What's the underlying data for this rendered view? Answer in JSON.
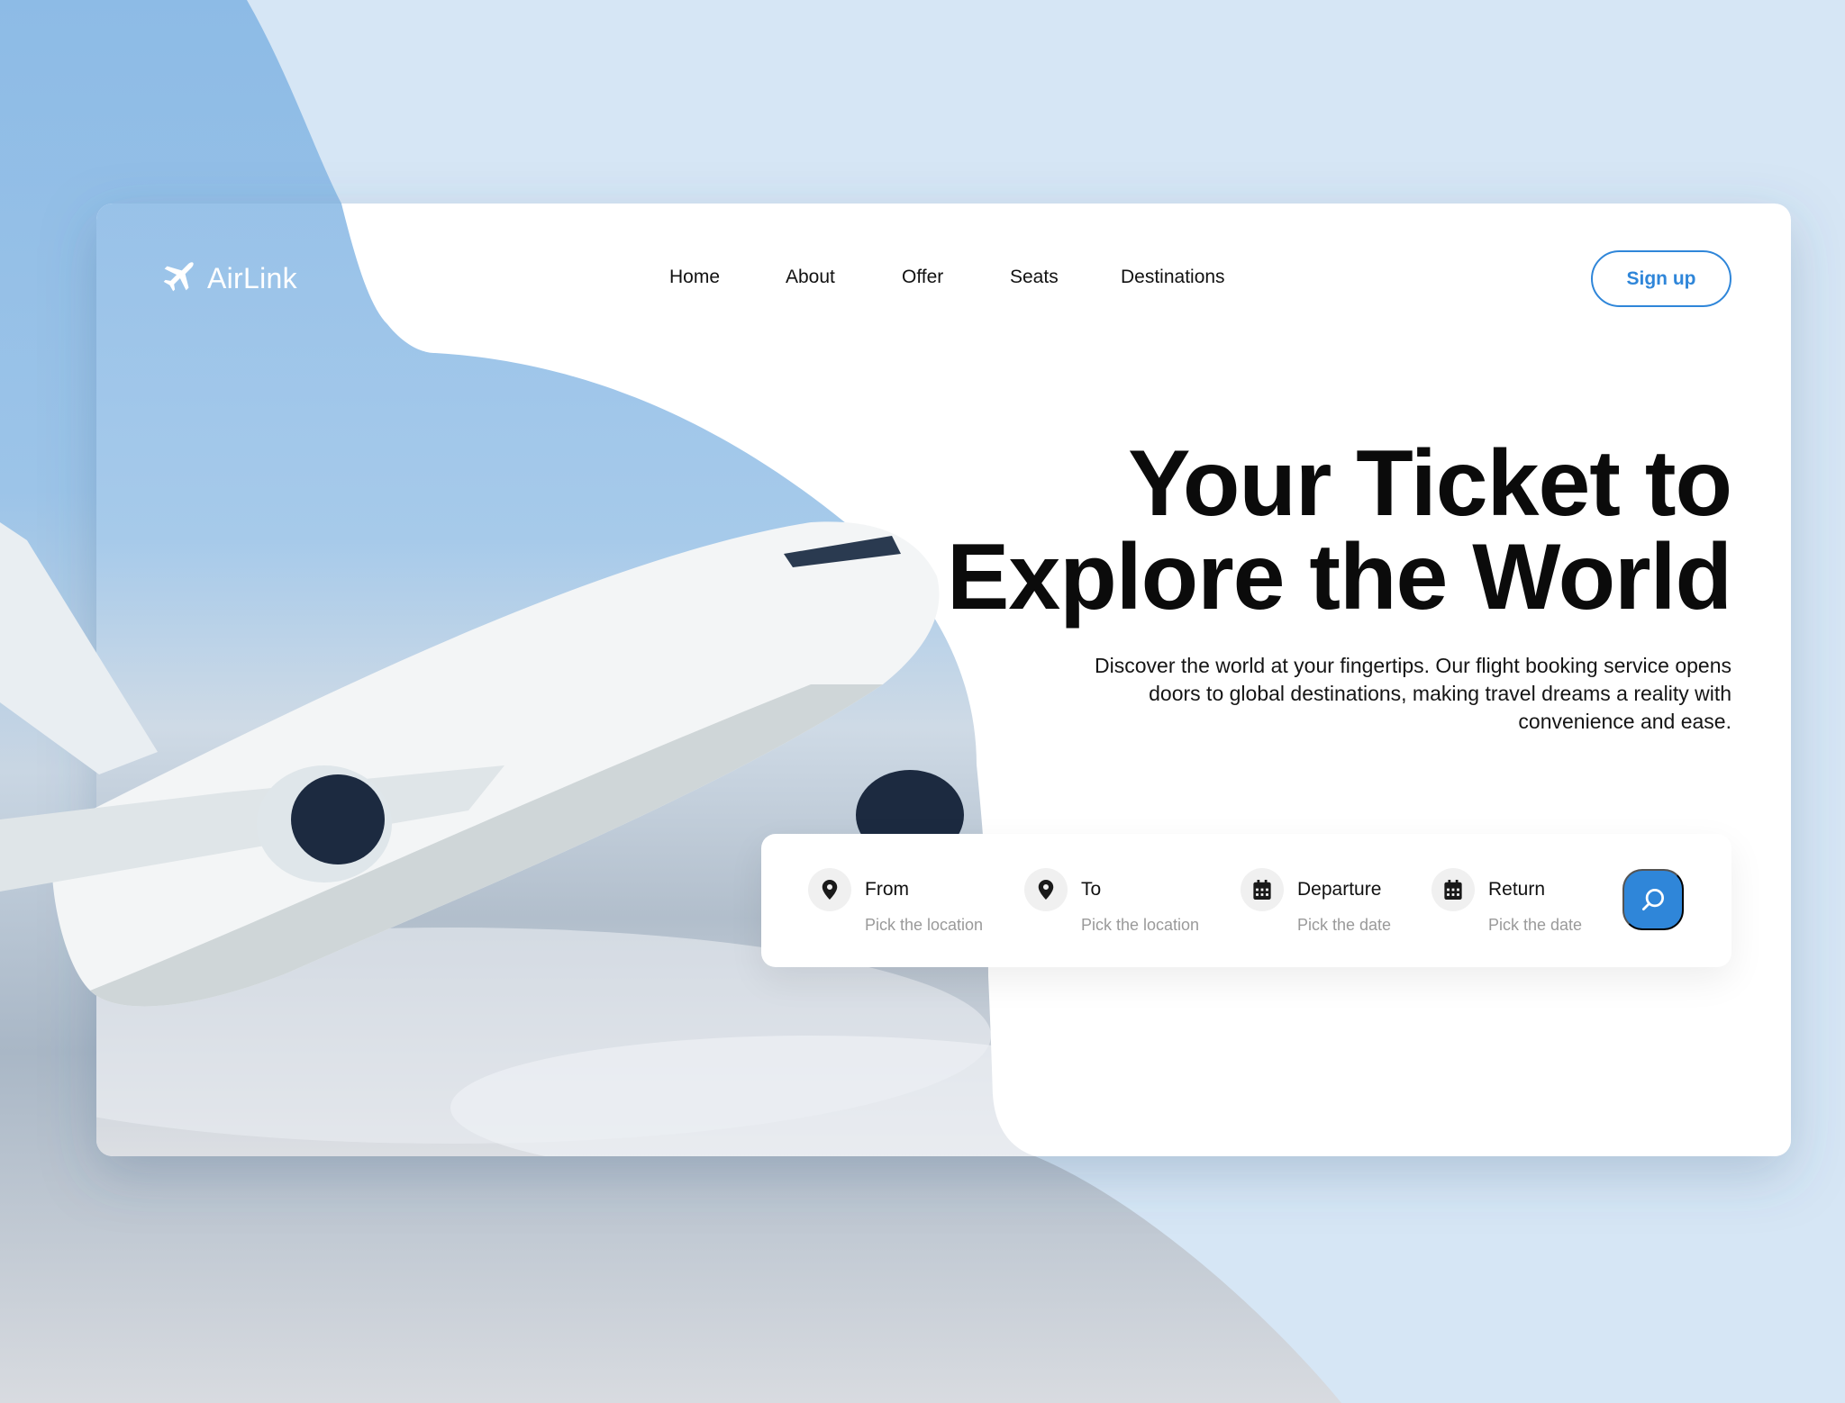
{
  "brand": {
    "name": "AirLink",
    "icon": "airplane-icon"
  },
  "nav": {
    "items": [
      "Home",
      "About",
      "Offer",
      "Seats",
      "Destinations"
    ]
  },
  "signup_label": "Sign up",
  "hero": {
    "title_line1": "Your Ticket to",
    "title_line2": "Explore the World",
    "description": "Discover the world at your fingertips. Our flight booking service opens doors to global destinations, making travel dreams a reality with convenience and ease."
  },
  "search": {
    "fields": [
      {
        "label": "From",
        "placeholder": "Pick the location",
        "icon": "location-pin-icon"
      },
      {
        "label": "To",
        "placeholder": "Pick the location",
        "icon": "location-pin-icon"
      },
      {
        "label": "Departure",
        "placeholder": "Pick the date",
        "icon": "calendar-icon"
      },
      {
        "label": "Return",
        "placeholder": "Pick the date",
        "icon": "calendar-icon"
      }
    ],
    "button_icon": "search-icon"
  },
  "colors": {
    "accent": "#2f86d9",
    "background": "#d6e6f5",
    "text": "#0b0b0b"
  }
}
